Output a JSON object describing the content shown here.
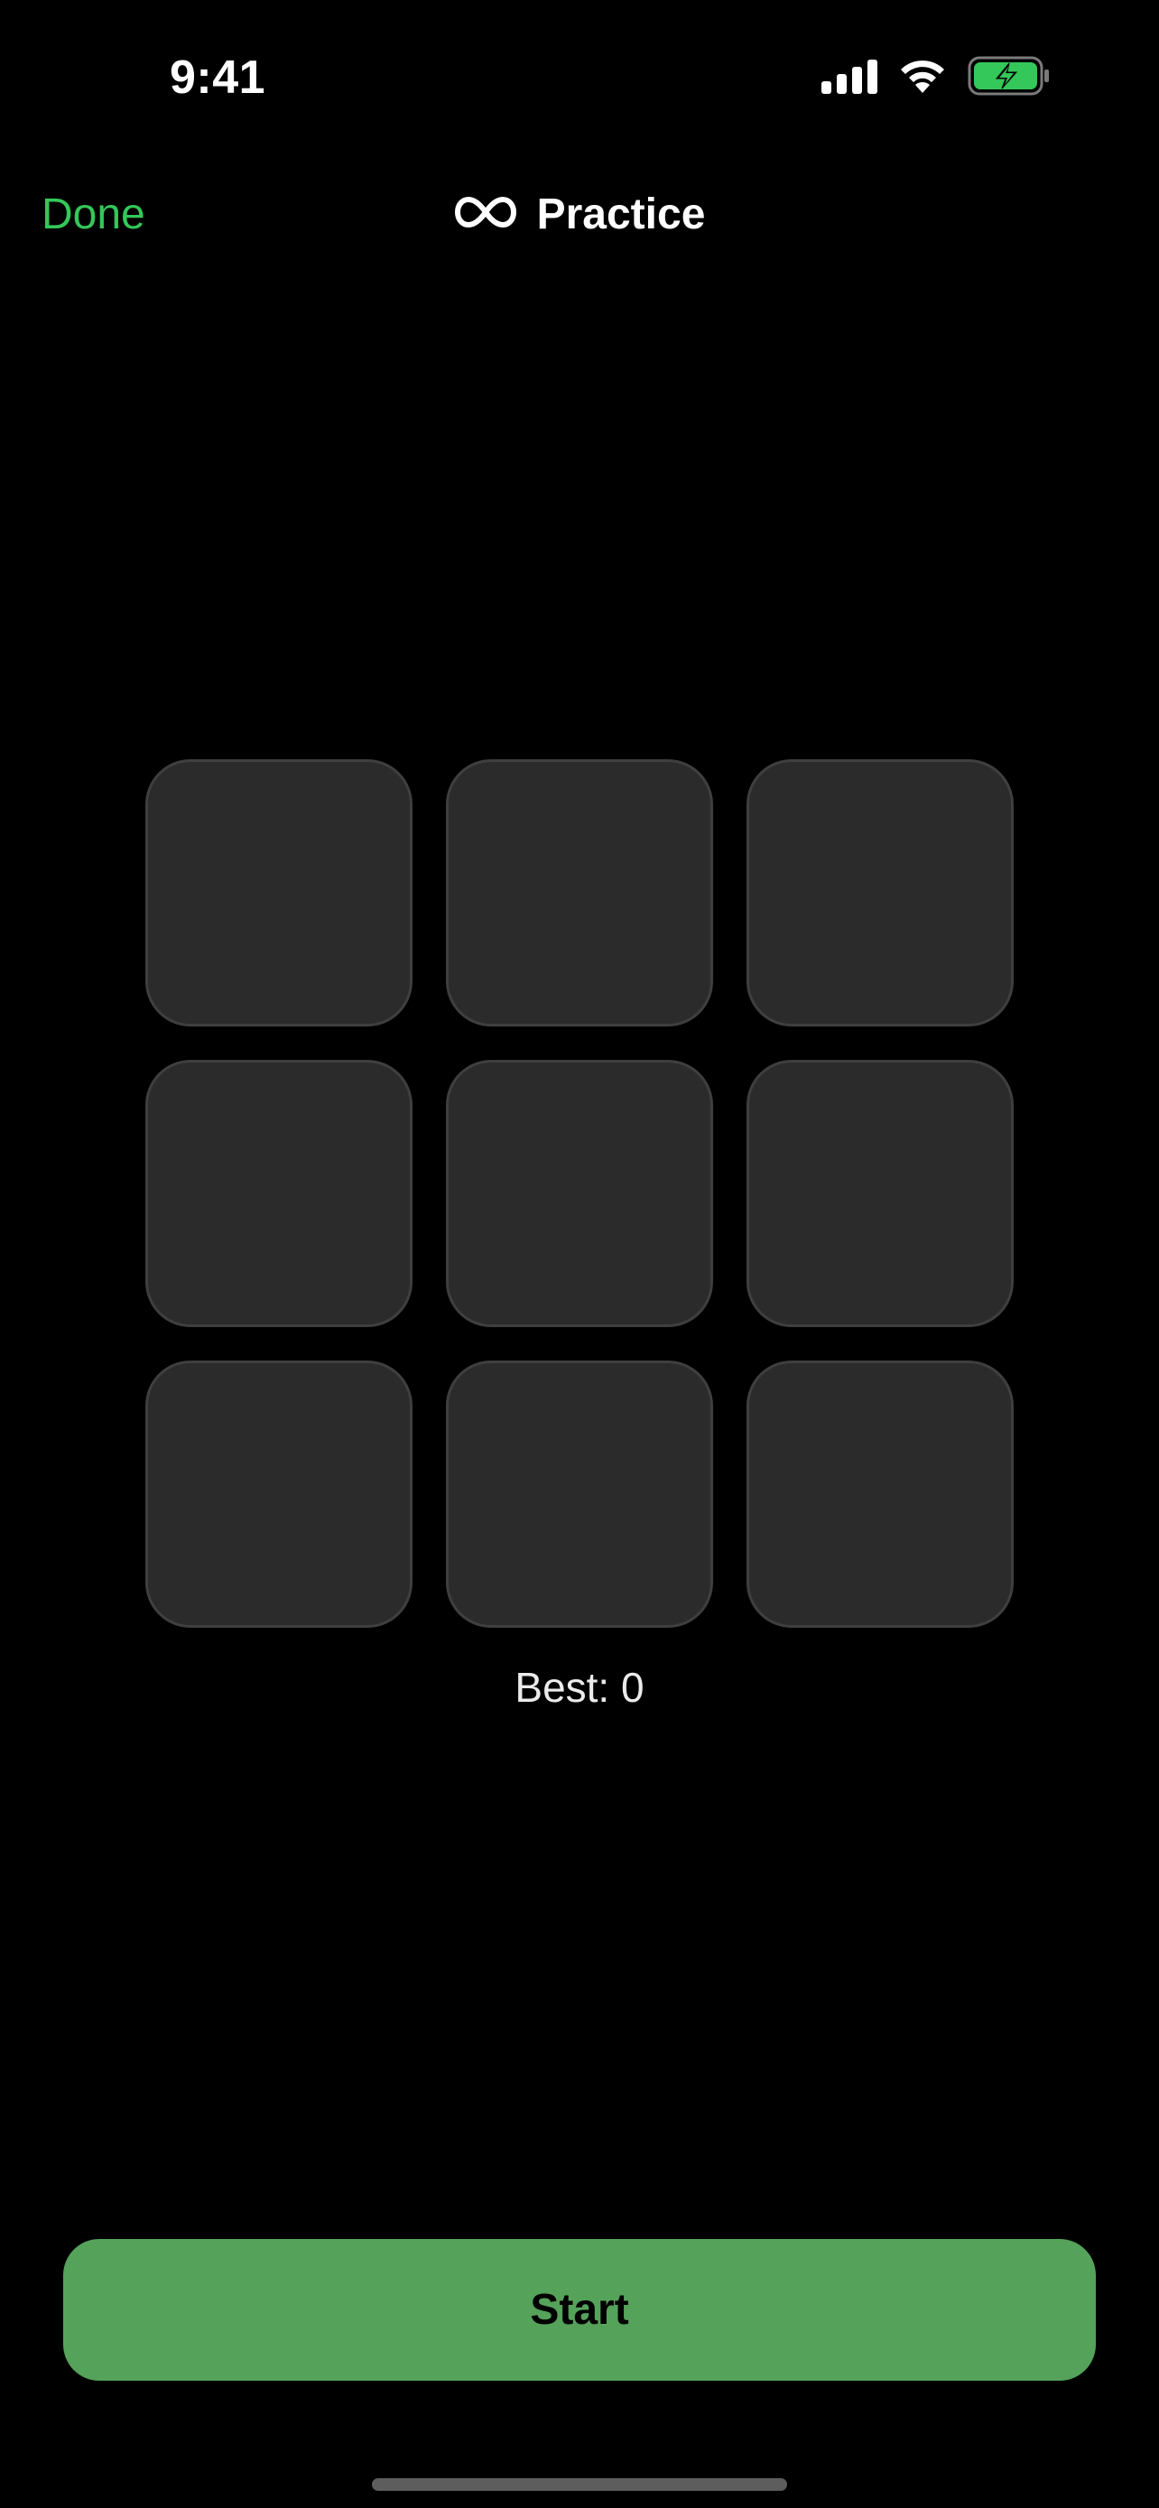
{
  "status_bar": {
    "time": "9:41",
    "signal_icon": "cellular-signal-icon",
    "wifi_icon": "wifi-icon",
    "battery_icon": "battery-charging-icon"
  },
  "nav": {
    "done_label": "Done",
    "title_icon": "infinity-icon",
    "title": "Practice"
  },
  "grid": {
    "rows": 3,
    "cols": 3
  },
  "best_label": "Best: 0",
  "start_label": "Start",
  "colors": {
    "background": "#000000",
    "accent": "#34c759",
    "tile": "#2b2b2b",
    "tile_border": "#3f3f3f",
    "start_button": "#55a25b"
  }
}
